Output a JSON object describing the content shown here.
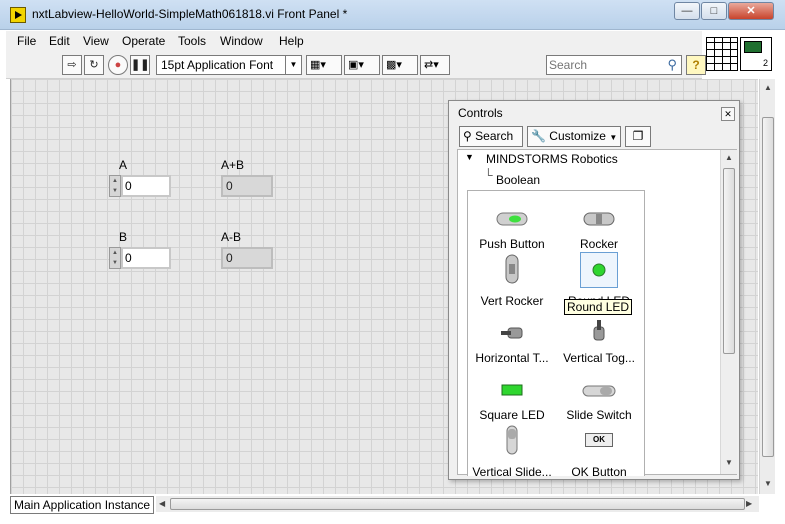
{
  "window": {
    "title": "nxtLabview-HelloWorld-SimpleMath061818.vi Front Panel *",
    "min_glyph": "—",
    "max_glyph": "□",
    "close_glyph": "✕"
  },
  "menu": [
    "File",
    "Edit",
    "View",
    "Operate",
    "Tools",
    "Window",
    "Help"
  ],
  "toolbar": {
    "font_select": "15pt Application Font",
    "search_placeholder": "Search",
    "icons": [
      "run-arrow-icon",
      "run-continuously-icon",
      "abort-icon",
      "pause-icon",
      "align-icon",
      "distribute-icon",
      "resize-icon",
      "reorder-icon",
      "help-icon"
    ],
    "vi_icon_number": "2"
  },
  "panel": {
    "controls": [
      {
        "label": "A",
        "value": "0"
      },
      {
        "label": "B",
        "value": "0"
      }
    ],
    "indicators": [
      {
        "label": "A+B",
        "value": "0"
      },
      {
        "label": "A-B",
        "value": "0"
      }
    ]
  },
  "palette": {
    "title": "Controls",
    "search_label": "Search",
    "customize_label": "Customize",
    "category": "MINDSTORMS Robotics",
    "subcategory": "Boolean",
    "items": [
      "Push Button",
      "Rocker",
      "Vert Rocker",
      "Round LED",
      "Horizontal T...",
      "Vertical Tog...",
      "Square LED",
      "Slide Switch",
      "Vertical Slide...",
      "OK Button"
    ],
    "tooltip": "Round LED",
    "ok_button_text": "OK"
  },
  "status": {
    "instance": "Main Application Instance"
  },
  "colors": {
    "led_on": "#2fd62f",
    "grid": "#e8e8e8"
  }
}
